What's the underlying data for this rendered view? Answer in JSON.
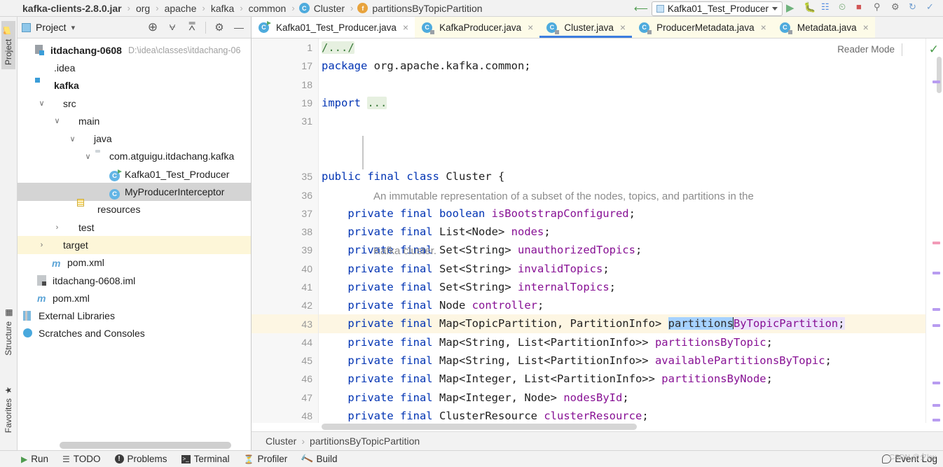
{
  "navbar": {
    "breadcrumbs": [
      {
        "label": "kafka-clients-2.8.0.jar",
        "icon": "",
        "bold": true
      },
      {
        "label": "org",
        "icon": "",
        "bold": false
      },
      {
        "label": "apache",
        "icon": "",
        "bold": false
      },
      {
        "label": "kafka",
        "icon": "",
        "bold": false
      },
      {
        "label": "common",
        "icon": "",
        "bold": false
      },
      {
        "label": "Cluster",
        "icon": "class-icon",
        "bold": false
      },
      {
        "label": "partitionsByTopicPartition",
        "icon": "field-icon",
        "bold": false
      }
    ],
    "separator": "›",
    "run_config": "Kafka01_Test_Producer",
    "run_config_icon": "run-configuration-icon",
    "dropdown_icon": "chevron-down-icon"
  },
  "left_strip": {
    "project_tab": "Project",
    "structure_tab": "Structure",
    "favorites_tab": "Favorites"
  },
  "project_panel": {
    "title": "Project",
    "title_caret": "▾",
    "toolbar": [
      {
        "name": "locate-icon",
        "glyph": "⊕"
      },
      {
        "name": "expand-all-icon",
        "glyph": "⩝"
      },
      {
        "name": "collapse-all-icon",
        "glyph": "⩞"
      },
      {
        "name": "settings-gear-icon",
        "glyph": "⚙"
      },
      {
        "name": "hide-panel-icon",
        "glyph": "—"
      }
    ],
    "tree": [
      {
        "label": "itdachang-0608",
        "sub": "D:\\idea\\classes\\itdachang-06",
        "indent": 0,
        "arrow": "",
        "icon": "project-icon",
        "bold": true,
        "state": ""
      },
      {
        "label": ".idea",
        "sub": "",
        "indent": 1,
        "arrow": "",
        "icon": "folder-icon",
        "bold": false,
        "state": ""
      },
      {
        "label": "kafka",
        "sub": "",
        "indent": 1,
        "arrow": "",
        "icon": "module-folder-icon",
        "bold": true,
        "state": ""
      },
      {
        "label": "src",
        "sub": "",
        "indent": 1,
        "arrow": "∨",
        "icon": "folder-icon",
        "bold": false,
        "state": ""
      },
      {
        "label": "main",
        "sub": "",
        "indent": 2,
        "arrow": "∨",
        "icon": "folder-icon",
        "bold": false,
        "state": ""
      },
      {
        "label": "java",
        "sub": "",
        "indent": 3,
        "arrow": "∨",
        "icon": "source-folder-icon",
        "bold": false,
        "state": ""
      },
      {
        "label": "com.atguigu.itdachang.kafka",
        "sub": "",
        "indent": 4,
        "arrow": "∨",
        "icon": "package-icon",
        "bold": false,
        "state": ""
      },
      {
        "label": "Kafka01_Test_Producer",
        "sub": "",
        "indent": 5,
        "arrow": "",
        "icon": "runnable-class-icon",
        "bold": false,
        "state": ""
      },
      {
        "label": "MyProducerInterceptor",
        "sub": "",
        "indent": 5,
        "arrow": "",
        "icon": "class-icon",
        "bold": false,
        "state": "selected"
      },
      {
        "label": "resources",
        "sub": "",
        "indent": 3,
        "arrow": "",
        "icon": "resources-folder-icon",
        "bold": false,
        "state": ""
      },
      {
        "label": "test",
        "sub": "",
        "indent": 2,
        "arrow": "›",
        "icon": "folder-icon",
        "bold": false,
        "state": ""
      },
      {
        "label": "target",
        "sub": "",
        "indent": 1,
        "arrow": "›",
        "icon": "excluded-folder-icon",
        "bold": false,
        "state": "highlighted"
      },
      {
        "label": "pom.xml",
        "sub": "",
        "indent": 2,
        "arrow": "",
        "icon": "maven-icon",
        "bold": false,
        "state": ""
      },
      {
        "label": "itdachang-0608.iml",
        "sub": "",
        "indent": 1,
        "arrow": "",
        "icon": "iml-icon",
        "bold": false,
        "state": ""
      },
      {
        "label": "pom.xml",
        "sub": "",
        "indent": 1,
        "arrow": "",
        "icon": "maven-icon",
        "bold": false,
        "state": ""
      },
      {
        "label": "External Libraries",
        "sub": "",
        "indent": 0,
        "arrow": "",
        "icon": "library-icon",
        "bold": false,
        "state": ""
      },
      {
        "label": "Scratches and Consoles",
        "sub": "",
        "indent": 0,
        "arrow": "",
        "icon": "scratches-icon",
        "bold": false,
        "state": ""
      }
    ]
  },
  "editor": {
    "tabs": [
      {
        "label": "Kafka01_Test_Producer.java",
        "icon": "runnable-class-icon",
        "active": false,
        "readonly": false
      },
      {
        "label": "KafkaProducer.java",
        "icon": "library-class-icon",
        "active": false,
        "readonly": true
      },
      {
        "label": "Cluster.java",
        "icon": "library-class-icon",
        "active": true,
        "readonly": true
      },
      {
        "label": "ProducerMetadata.java",
        "icon": "library-class-icon",
        "active": false,
        "readonly": true
      },
      {
        "label": "Metadata.java",
        "icon": "library-class-icon",
        "active": false,
        "readonly": true
      }
    ],
    "tab_close_glyph": "×",
    "reader_mode_label": "Reader Mode",
    "inspection_ok_glyph": "✓",
    "line_numbers": [
      "1",
      "17",
      "18",
      "19",
      "31",
      "",
      "",
      "35",
      "36",
      "",
      "37",
      "38",
      "39",
      "40",
      "41",
      "42",
      "43",
      "44",
      "45",
      "46",
      "47",
      "48"
    ],
    "current_line": "43",
    "fold_glyph": "+",
    "license_fold": "/.../",
    "import_fold": "...",
    "javadoc": [
      "An immutable representation of a subset of the nodes, topics, and partitions in the",
      "Kafka cluster."
    ],
    "code_lines": [
      "package org.apache.kafka.common;",
      "",
      "import ...",
      "",
      "public final class Cluster {",
      "",
      "    private final boolean isBootstrapConfigured;",
      "    private final List<Node> nodes;",
      "    private final Set<String> unauthorizedTopics;",
      "    private final Set<String> invalidTopics;",
      "    private final Set<String> internalTopics;",
      "    private final Node controller;",
      "    private final Map<TopicPartition, PartitionInfo> partitionsByTopicPartition;",
      "    private final Map<String, List<PartitionInfo>> partitionsByTopic;",
      "    private final Map<String, List<PartitionInfo>> availablePartitionsByTopic;",
      "    private final Map<Integer, List<PartitionInfo>> partitionsByNode;",
      "    private final Map<Integer, Node> nodesById;",
      "    private final ClusterResource clusterResource;"
    ],
    "selected_text": "partitions",
    "highlighted_identifier": "ByTopicPartition",
    "breadcrumb": [
      "Cluster",
      "partitionsByTopicPartition"
    ],
    "breadcrumb_separator": "›"
  },
  "statusbar": {
    "items": [
      {
        "label": "Run",
        "icon": "run-icon"
      },
      {
        "label": "TODO",
        "icon": "todo-icon"
      },
      {
        "label": "Problems",
        "icon": "problems-icon"
      },
      {
        "label": "Terminal",
        "icon": "terminal-icon"
      },
      {
        "label": "Profiler",
        "icon": "profiler-icon"
      },
      {
        "label": "Build",
        "icon": "build-icon"
      }
    ],
    "event_log": "Event Log",
    "watermark": "CSDN @夕kw"
  },
  "colors": {
    "accent": "#3c7ddf",
    "keyword": "#0033b3",
    "field": "#871094",
    "selection": "#a6d2ff",
    "identifier_highlight": "#ece3fb",
    "current_line": "#fdf6e3",
    "panel_bg": "#f2f2f2"
  }
}
